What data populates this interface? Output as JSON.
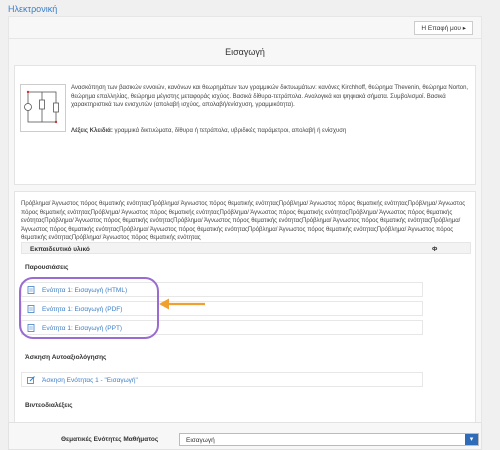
{
  "course": {
    "title": "Ηλεκτρονική"
  },
  "toolbar": {
    "my_course_label": "Η Επαφή μου ▸"
  },
  "unit": {
    "title": "Εισαγωγή"
  },
  "description": {
    "text": "Ανασκόπηση των βασικών εννοιών, κανόνων και θεωρημάτων των γραμμικών δικτυωμάτων: κανόνες Kirchhoff, θεώρημα Thevenin, θεώρημα Norton, θεώρημα επαλληλίας, θεώρημα μέγιστης μεταφοράς ισχύος. Βασικά δίθυρα-τετράπολα. Αναλογικά και ψηφιακά σήματα. Συμβολισμοί. Βασικά χαρακτηριστικά των ενισχυτών (απολαβή ισχύος, απολαβή/ενίσχυση, γραμμικότητα).",
    "keywords_label": "Λέξεις Κλειδιά:",
    "keywords": "γραμμικά δικτυώματα, δίθυρα ή τετράπολα, υβριδικές παράμετροι, απολαβή ή ενίσχυση"
  },
  "prerequisites": {
    "text": "Πρόβλημα/ Άγνωστος πόρος θεματικής ενότηταςΠρόβλημα/ Άγνωστος πόρος θεματικής ενότηταςΠρόβλημα/ Άγνωστος πόρος θεματικής ενότηταςΠρόβλημα/ Άγνωστος πόρος θεματικής ενότηταςΠρόβλημα/ Άγνωστος πόρος θεματικής ενότηταςΠρόβλημα/ Άγνωστος πόρος θεματικής ενότηταςΠρόβλημα/ Άγνωστος πόρος θεματικής ενότηταςΠρόβλημα/ Άγνωστος πόρος θεματικής ενότηταςΠρόβλημα/ Άγνωστος πόρος θεματικής ενότηταςΠρόβλημα/ Άγνωστος πόρος θεματικής ενότηταςΠρόβλημα/ Άγνωστος πόρος θεματικής ενότηταςΠρόβλημα/ Άγνωστος πόρος θεματικής ενότηταςΠρόβλημα/ Άγνωστος πόρος θεματικής ενότηταςΠρόβλημα/ Άγνωστος πόρος θεματικής ενότηταςΠρόβλημα/ Άγνωστος πόρος θεματικής ενότητας"
  },
  "materials": {
    "header": "Εκπαιδευτικό υλικό",
    "header_right": "Φ",
    "presentations_label": "Παρουσιάσεις",
    "presentations": [
      {
        "label": "Ενότητα 1: Εισαγωγή (HTML)"
      },
      {
        "label": "Ενότητα 1: Εισαγωγή (PDF)"
      },
      {
        "label": "Ενότητα 1: Εισαγωγή (PPT)"
      }
    ],
    "self_assessment_label": "Άσκηση Αυτοαξιολόγησης",
    "self_assessment_item": "Άσκηση Ενότητας 1 - \"Εισαγωγή\"",
    "videos_label": "Βιντεοδιαλέξεις"
  },
  "units_select": {
    "label": "Θεματικές Ενότητες Μαθήματος",
    "value": "Εισαγωγή"
  },
  "colors": {
    "link": "#3b7ec8",
    "highlight": "#9a6bd0",
    "arrow": "#f0a030",
    "select_button": "#2e6bb8"
  }
}
